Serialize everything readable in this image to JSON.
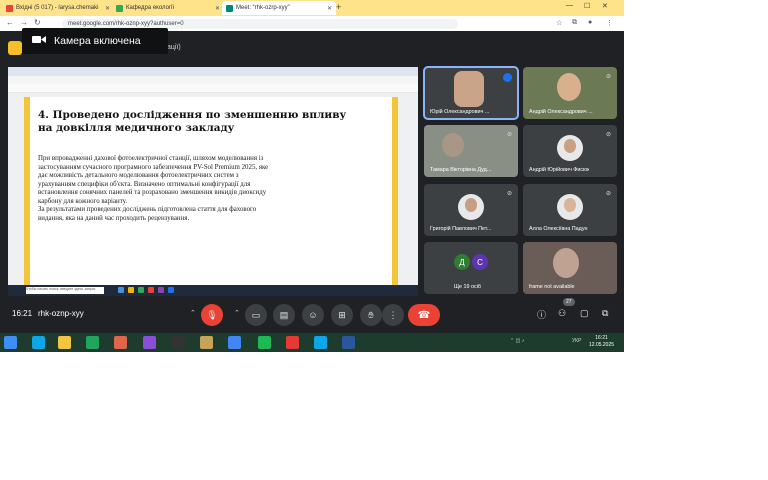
{
  "browser": {
    "tabs": [
      {
        "label": "Вхідні (5 017) - larysa.chemaki",
        "color": "#ea4335"
      },
      {
        "label": "Кафедра екології",
        "color": "#34a853"
      },
      {
        "label": "Meet: “rhk-ozrp-xyy”",
        "color": "#00897b"
      }
    ],
    "new_tab": "+",
    "url": "meet.google.com/rhk-oznp-xyy?authuser=0"
  },
  "meet": {
    "toast": "Камера включена",
    "top_text": "ації)",
    "time": "16:21",
    "meeting_code": "rhk-oznp-xyy",
    "participants_count": "27"
  },
  "shared_screen": {
    "heading": "4. Проведено дослідження по зменшенню впливу на довкілля медичного закладу",
    "body": [
      "При впровадженні дахової фотоелектричної станції, шляхом моделювання із",
      "застосуванням сучасного програмного забезпечення PV-Sol Premium 2025, яке",
      "дає можливість детального моделювання фотоелектричних систем з",
      "урахуванням специфіки об'єкта. Визначено оптимальні конфігурації для",
      "встановлення сонячних панелей та розраховано зменшення викидів диоксиду",
      "карбону для кожного варіанту.",
      "За результатами проведених досліджень підготовлена стаття для фахового",
      "видання, яка на даний час проходить рецензування."
    ],
    "taskbar_search": "Чтобы начать поиск, введите здесь запрос"
  },
  "tiles": [
    {
      "name": "Юрій Олександрович ..."
    },
    {
      "name": "Андрій Олександрович ..."
    },
    {
      "name": "Тамара Вікторівна Дуд..."
    },
    {
      "name": "Андрій Юрійович Фисюк"
    },
    {
      "name": "Григорій Павлович Пет..."
    },
    {
      "name": "Алла Олексіївна Падун"
    },
    {
      "name": "Ще 19 осіб",
      "initials": [
        "Д",
        "С"
      ]
    },
    {
      "name": "frame not available"
    }
  ],
  "windows": {
    "clock_time": "16:21",
    "clock_date": "12.05.2025",
    "lang": "УКР"
  },
  "colors": {
    "meet_bg": "#202124",
    "tile_bg": "#3c4043",
    "end_call": "#ea4335",
    "tab_strip": "#ffe38a",
    "doc_accent": "#f3c53a"
  }
}
